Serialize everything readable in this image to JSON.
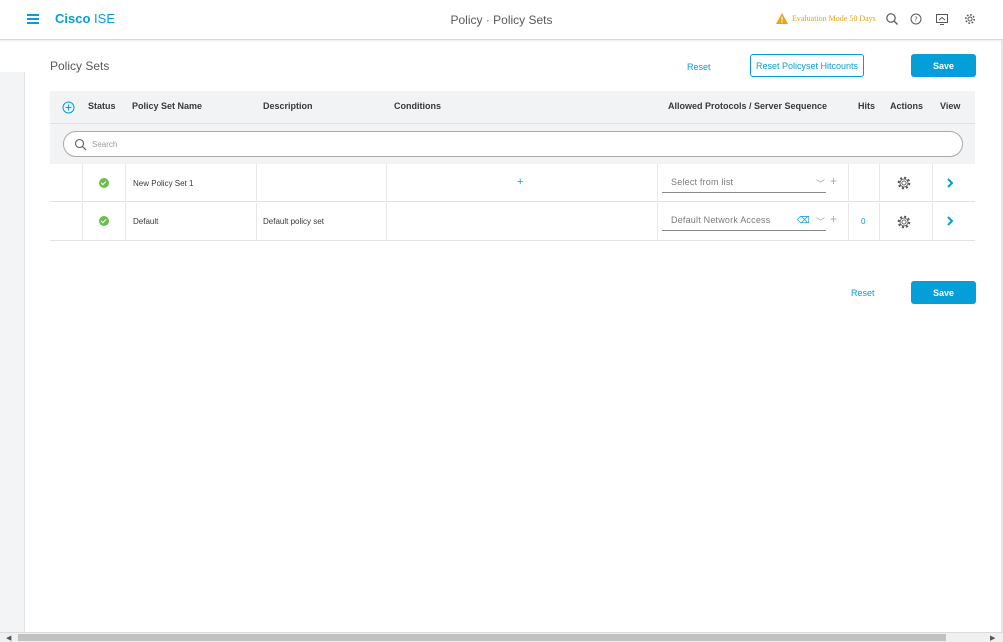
{
  "header": {
    "brand_bold": "Cisco",
    "brand_product": "ISE",
    "page_title": "Policy · Policy Sets",
    "evaluation_text": "Evaluation Mode 50 Days"
  },
  "section": {
    "title": "Policy Sets"
  },
  "toolbar": {
    "reset_label": "Reset",
    "reset_hitcounts_label": "Reset Policyset Hitcounts",
    "save_label": "Save"
  },
  "table": {
    "columns": [
      "Status",
      "Policy Set Name",
      "Description",
      "Conditions",
      "Allowed Protocols / Server Sequence",
      "Hits",
      "Actions",
      "View"
    ],
    "search_placeholder": "Search",
    "rows": [
      {
        "status": "enabled",
        "name": "New Policy Set 1",
        "description": "",
        "condition_action": "+",
        "protocol": "Select from list",
        "hits": ""
      },
      {
        "status": "enabled",
        "name": "Default",
        "description": "Default policy set",
        "condition_action": "",
        "protocol": "Default Network Access",
        "hits": "0"
      }
    ]
  },
  "footer": {
    "reset_label": "Reset",
    "save_label": "Save"
  },
  "colors": {
    "accent": "#049fd9",
    "warning": "#e8a317",
    "status_ok": "#6abf4b"
  },
  "icons": [
    "hamburger-menu-icon",
    "warning-icon",
    "search-icon",
    "help-icon",
    "screen-share-icon",
    "gear-icon",
    "add-circle-icon",
    "chevron-down-icon",
    "plus-icon",
    "clear-icon",
    "chevron-right-icon"
  ]
}
